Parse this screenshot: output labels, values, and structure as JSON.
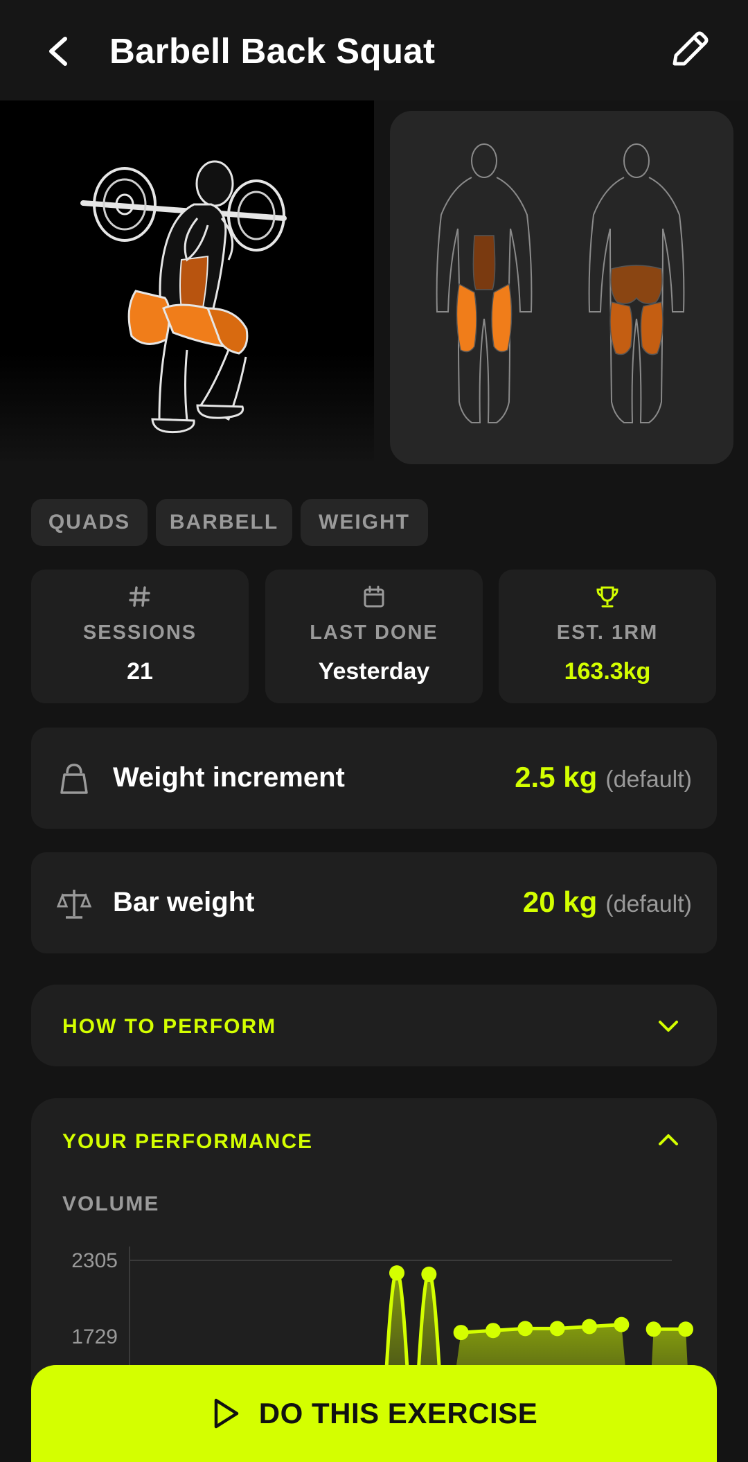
{
  "header": {
    "title": "Barbell Back Squat"
  },
  "tags": [
    "QUADS",
    "BARBELL",
    "WEIGHT"
  ],
  "stats": [
    {
      "icon": "hash-icon",
      "label": "SESSIONS",
      "value": "21"
    },
    {
      "icon": "calendar-icon",
      "label": "LAST DONE",
      "value": "Yesterday"
    },
    {
      "icon": "trophy-icon",
      "label": "EST. 1RM",
      "value": "163.3kg"
    }
  ],
  "settings": {
    "weight_increment": {
      "label": "Weight increment",
      "value": "2.5 kg",
      "note": "(default)"
    },
    "bar_weight": {
      "label": "Bar weight",
      "value": "20 kg",
      "note": "(default)"
    }
  },
  "how_to": {
    "title": "HOW TO PERFORM"
  },
  "performance": {
    "title": "YOUR PERFORMANCE",
    "subtitle": "VOLUME"
  },
  "chart_data": {
    "type": "area",
    "title": "VOLUME",
    "ytick_labels": [
      "2305",
      "1729"
    ],
    "ylim": [
      1729,
      2305
    ],
    "series": [
      {
        "points": [
          {
            "x": 1,
            "y": 2210
          },
          {
            "x": 2,
            "y": 2200
          },
          {
            "x": 3,
            "y": 1760
          },
          {
            "x": 4,
            "y": 1775
          },
          {
            "x": 5,
            "y": 1790
          },
          {
            "x": 6,
            "y": 1790
          },
          {
            "x": 7,
            "y": 1805
          },
          {
            "x": 8,
            "y": 1820
          },
          {
            "x": 9,
            "y": 1785
          },
          {
            "x": 10,
            "y": 1785
          }
        ]
      }
    ],
    "colors": {
      "line": "#d4ff00",
      "grid": "#3a3a3a"
    }
  },
  "cta": {
    "label": "DO THIS EXERCISE"
  },
  "colors": {
    "accent": "#d4ff00",
    "muscle": "#f07d1a",
    "card": "#1f1f1f",
    "background": "#141414"
  }
}
